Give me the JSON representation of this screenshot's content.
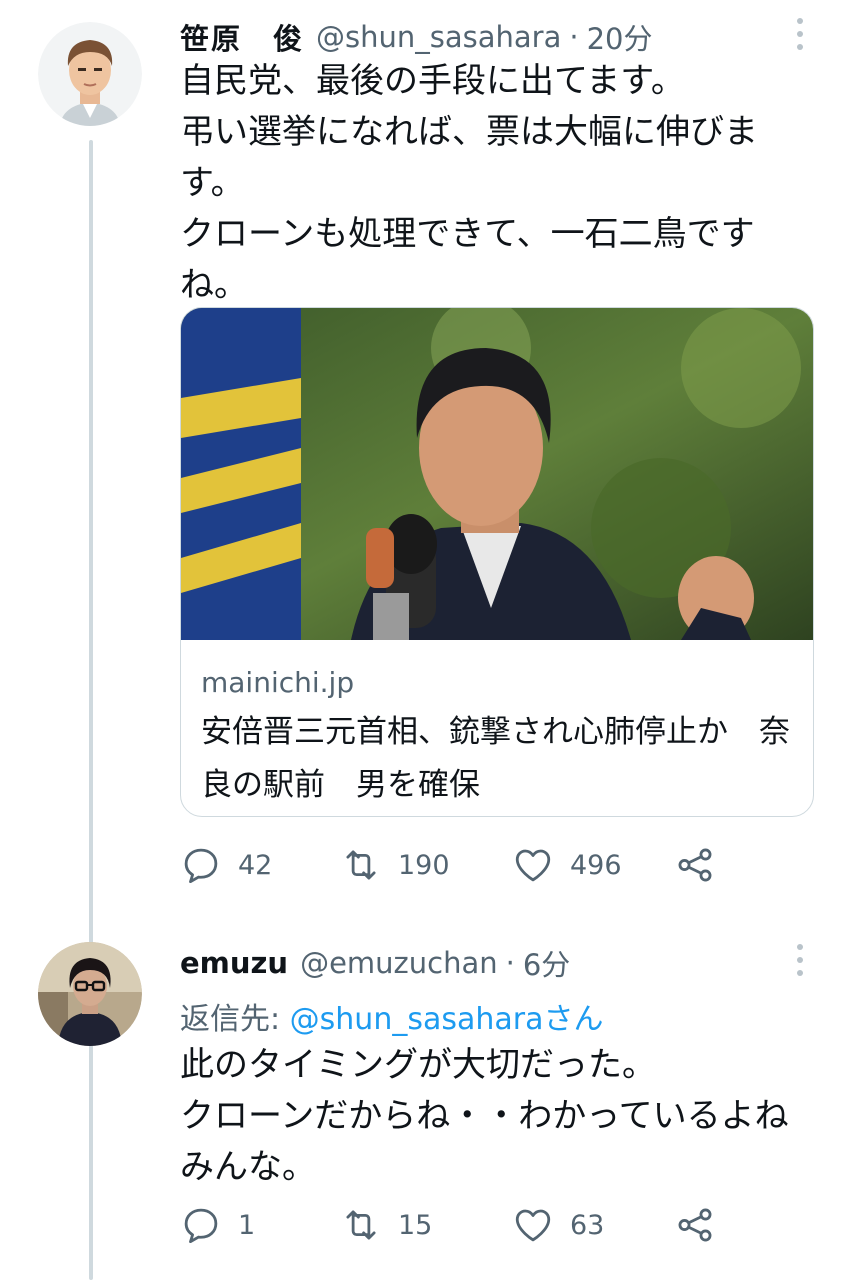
{
  "tweets": [
    {
      "name": "笹原　俊",
      "handle": "@shun_sasahara",
      "separator": "·",
      "time": "20分",
      "text": "自民党、最後の手段に出てます。\n弔い選挙になれば、票は大幅に伸びます。\nクローンも処理できて、一石二鳥ですね。",
      "card": {
        "domain": "mainichi.jp",
        "title": "安倍晋三元首相、銃撃され心肺停止か　奈良の駅前　男を確保"
      },
      "actions": {
        "replies": "42",
        "retweets": "190",
        "likes": "496"
      }
    },
    {
      "name": "emuzu",
      "handle": "@emuzuchan",
      "separator": "·",
      "time": "6分",
      "reply_prefix": "返信先: ",
      "reply_mention": "@shun_sasahara",
      "reply_suffix": "さん",
      "text": "此のタイミングが大切だった。\nクローンだからね・・わかっているよね\nみんな。",
      "actions": {
        "replies": "1",
        "retweets": "15",
        "likes": "63"
      }
    }
  ],
  "icons": {
    "reply": "reply-icon",
    "retweet": "retweet-icon",
    "like": "heart-icon",
    "share": "share-icon",
    "more": "more-vertical-icon"
  },
  "colors": {
    "text": "#0f1419",
    "secondary": "#536471",
    "link": "#1d9bf0",
    "thread_line": "#cfd9de"
  }
}
